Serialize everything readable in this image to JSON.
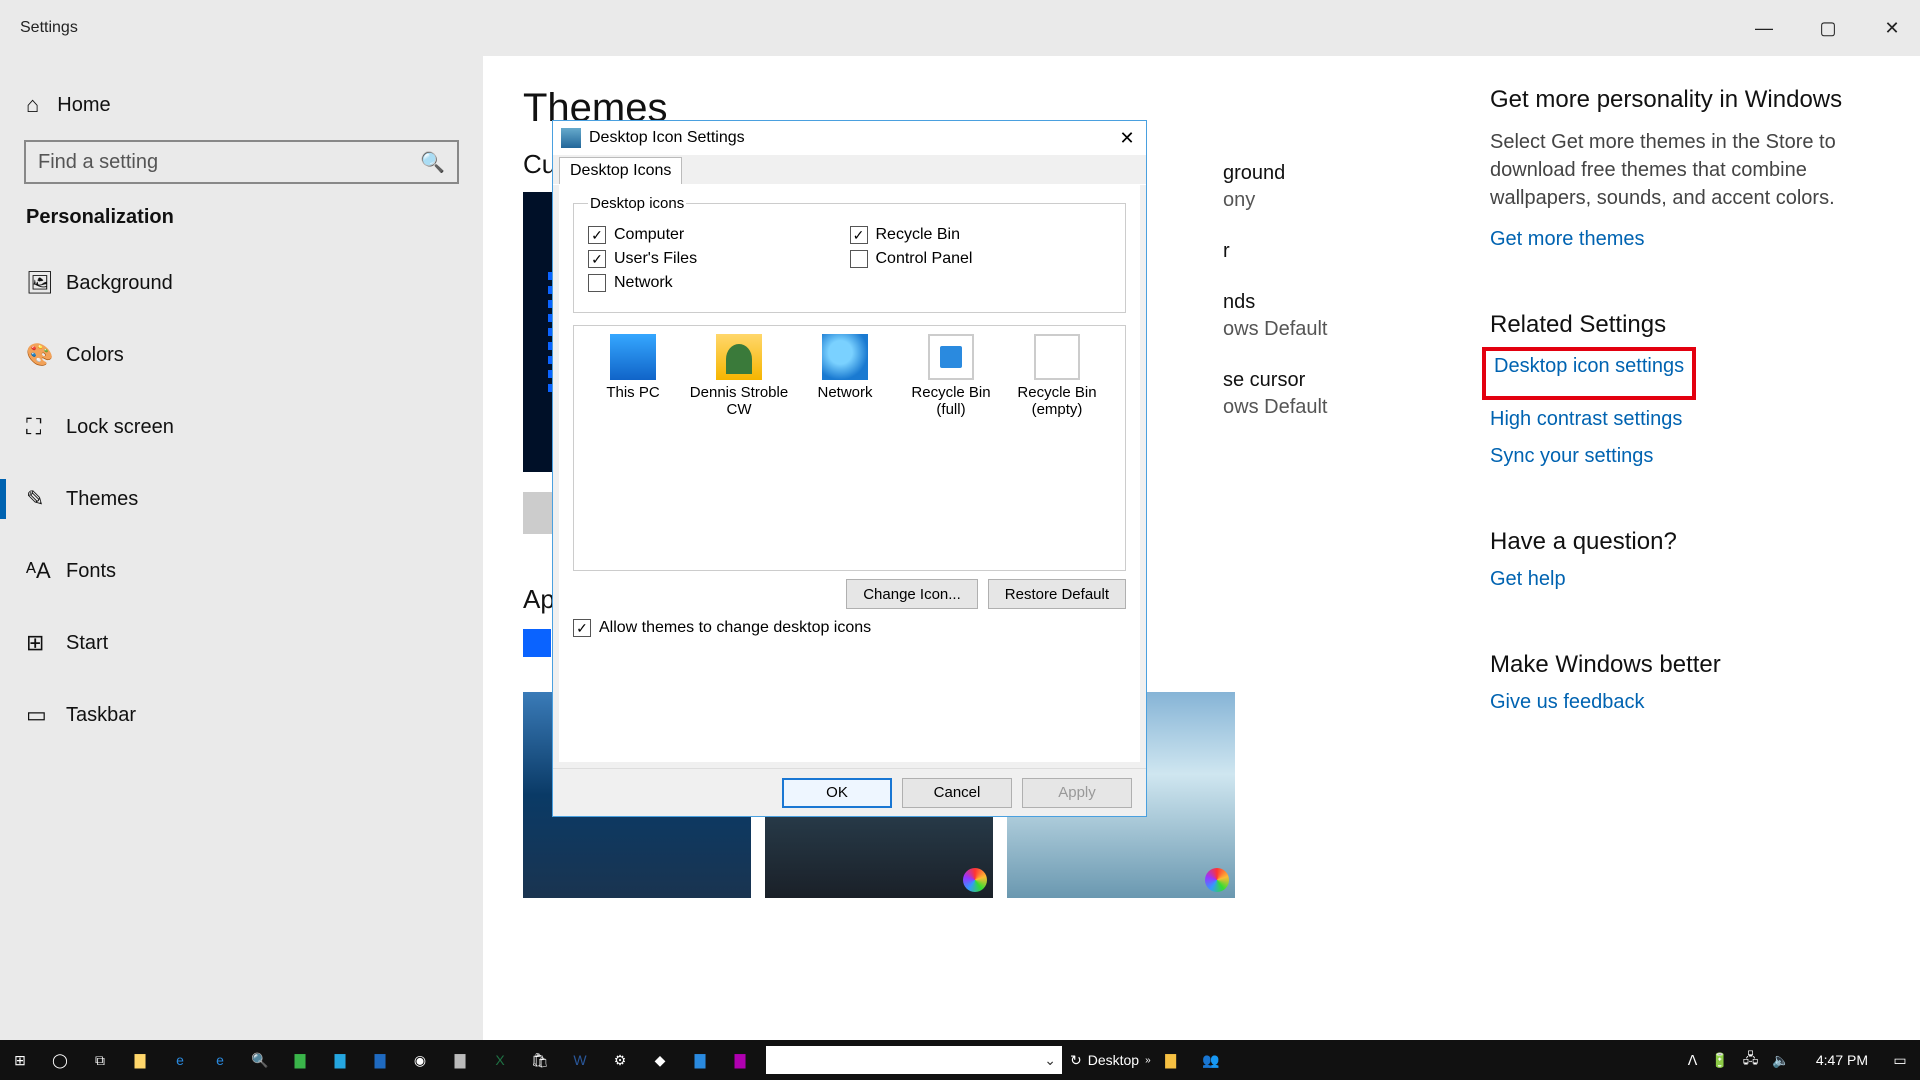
{
  "window": {
    "title": "Settings"
  },
  "nav": {
    "home": "Home",
    "search_placeholder": "Find a setting",
    "section": "Personalization",
    "items": [
      {
        "glyph": "▢",
        "label": "Background"
      },
      {
        "glyph": "◐",
        "label": "Colors"
      },
      {
        "glyph": "⛶",
        "label": "Lock screen"
      },
      {
        "glyph": "✎",
        "label": "Themes",
        "active": true
      },
      {
        "glyph": "ᴬA",
        "label": "Fonts"
      },
      {
        "glyph": "⊞",
        "label": "Start"
      },
      {
        "glyph": "▭",
        "label": "Taskbar"
      }
    ]
  },
  "main": {
    "heading": "Themes",
    "current": "Cu",
    "peek": {
      "bg": {
        "label": "ground",
        "value": "ony"
      },
      "color": {
        "label": "r",
        "value": ""
      },
      "snd": {
        "label": "nds",
        "value": "ows Default"
      },
      "cur": {
        "label": "se cursor",
        "value": "ows Default"
      }
    },
    "apply_heading": "Ap"
  },
  "side": {
    "h1": "Get more personality in Windows",
    "p1": "Select Get more themes in the Store to download free themes that combine wallpapers, sounds, and accent colors.",
    "link_more": "Get more themes",
    "h2": "Related Settings",
    "link_icons": "Desktop icon settings",
    "link_hc": "High contrast settings",
    "link_sync": "Sync your settings",
    "h3": "Have a question?",
    "link_help": "Get help",
    "h4": "Make Windows better",
    "link_fb": "Give us feedback"
  },
  "dialog": {
    "title": "Desktop Icon Settings",
    "tab": "Desktop Icons",
    "group": "Desktop icons",
    "cb": {
      "computer": "Computer",
      "users": "User's Files",
      "network": "Network",
      "recycle": "Recycle Bin",
      "control": "Control Panel"
    },
    "checked": {
      "computer": true,
      "users": true,
      "network": false,
      "recycle": true,
      "control": false
    },
    "icons": {
      "pc": "This PC",
      "user": "Dennis Stroble CW",
      "net": "Network",
      "binf": "Recycle Bin (full)",
      "bine": "Recycle Bin (empty)"
    },
    "changeicon": "Change Icon...",
    "restore": "Restore Default",
    "allow": "Allow themes to change desktop icons",
    "ok": "OK",
    "cancel": "Cancel",
    "apply": "Apply"
  },
  "taskbar": {
    "desktop_label": "Desktop",
    "clock": "4:47 PM"
  }
}
